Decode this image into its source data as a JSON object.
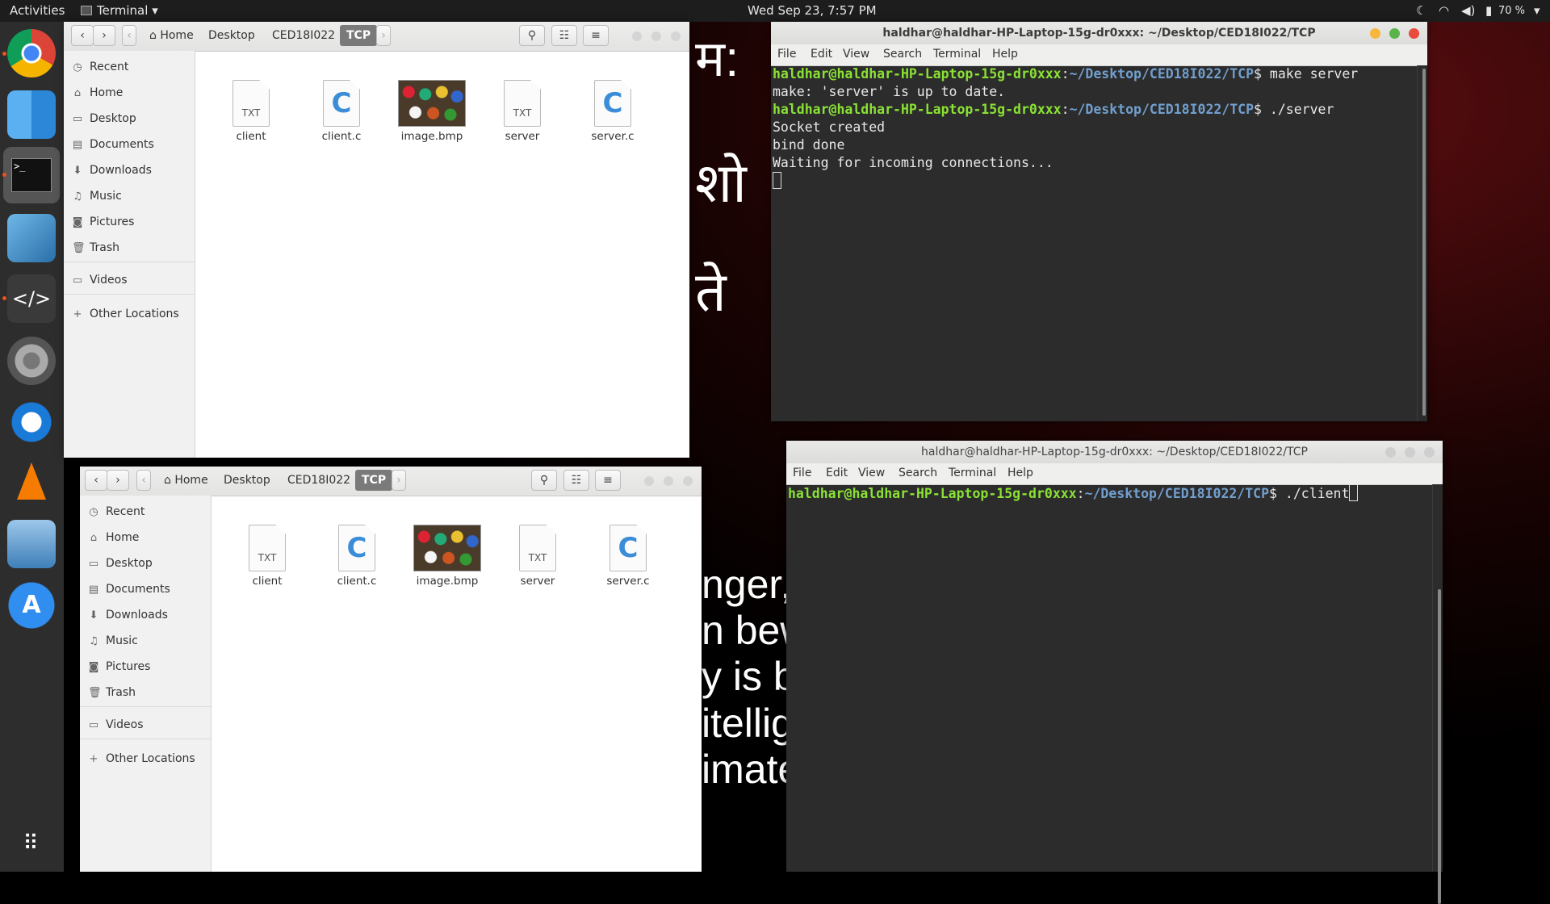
{
  "topbar": {
    "activities": "Activities",
    "app_menu": "Terminal",
    "clock": "Wed Sep 23,  7:57 PM",
    "battery": "70 %"
  },
  "dock": {
    "apps": [
      "chrome-icon",
      "finder-icon",
      "terminal-icon",
      "xcode-icon",
      "sublime-text-icon",
      "system-settings-icon",
      "browser-icon",
      "vlc-icon",
      "image-viewer-icon",
      "app-store-icon",
      "show-applications-icon"
    ]
  },
  "wallpaper_text": {
    "dev_line1": "म:",
    "dev_line2": "शो",
    "dev_line3": "ते",
    "en_line1": "nger,",
    "en_line2": "n bew",
    "en_line3": "y is bo",
    "en_line4": "itellig",
    "en_line5": "imate"
  },
  "file_manager_top": {
    "breadcrumbs": [
      "Home",
      "Desktop",
      "CED18I022",
      "TCP"
    ],
    "sidebar": [
      "Recent",
      "Home",
      "Desktop",
      "Documents",
      "Downloads",
      "Music",
      "Pictures",
      "Trash",
      "Videos",
      "Other Locations"
    ],
    "files": [
      {
        "name": "client",
        "type": "TXT"
      },
      {
        "name": "client.c",
        "type": "C"
      },
      {
        "name": "image.bmp",
        "type": "IMG"
      },
      {
        "name": "server",
        "type": "TXT"
      },
      {
        "name": "server.c",
        "type": "C"
      }
    ]
  },
  "file_manager_bottom": {
    "breadcrumbs": [
      "Home",
      "Desktop",
      "CED18I022",
      "TCP"
    ],
    "sidebar": [
      "Recent",
      "Home",
      "Desktop",
      "Documents",
      "Downloads",
      "Music",
      "Pictures",
      "Trash",
      "Videos",
      "Other Locations"
    ],
    "files": [
      {
        "name": "client",
        "type": "TXT"
      },
      {
        "name": "client.c",
        "type": "C"
      },
      {
        "name": "image.bmp",
        "type": "IMG"
      },
      {
        "name": "server",
        "type": "TXT"
      },
      {
        "name": "server.c",
        "type": "C"
      }
    ]
  },
  "terminal_server": {
    "title": "haldhar@haldhar-HP-Laptop-15g-dr0xxx: ~/Desktop/CED18I022/TCP",
    "menu": [
      "File",
      "Edit",
      "View",
      "Search",
      "Terminal",
      "Help"
    ],
    "prompt_user": "haldhar@haldhar-HP-Laptop-15g-dr0xxx",
    "prompt_path": "~/Desktop/CED18I022/TCP",
    "cmd1": " make server",
    "out1": "make: 'server' is up to date.",
    "cmd2": " ./server",
    "out2": "Socket created",
    "out3": "bind done",
    "out4": "Waiting for incoming connections..."
  },
  "terminal_client": {
    "title": "haldhar@haldhar-HP-Laptop-15g-dr0xxx: ~/Desktop/CED18I022/TCP",
    "menu": [
      "File",
      "Edit",
      "View",
      "Search",
      "Terminal",
      "Help"
    ],
    "prompt_user": "haldhar@haldhar-HP-Laptop-15g-dr0xxx",
    "prompt_path": "~/Desktop/CED18I022/TCP",
    "cmd1": " ./client"
  }
}
